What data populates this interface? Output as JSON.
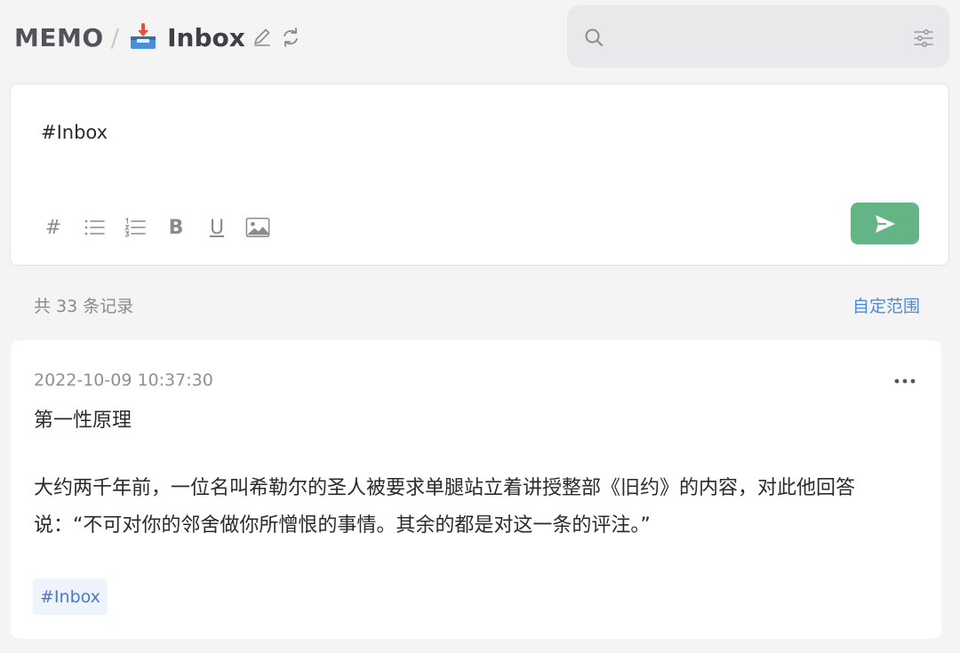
{
  "header": {
    "app_name": "MEMO",
    "separator": "/",
    "current_tag": "Inbox",
    "icons": [
      "inbox-tray-icon",
      "edit-pencil-icon",
      "sync-icon"
    ]
  },
  "search": {
    "placeholder": "",
    "value": "",
    "icons": [
      "search-icon",
      "filter-sliders-icon"
    ]
  },
  "editor": {
    "content": "#Inbox",
    "toolbar": {
      "tag": "#",
      "bold": "B",
      "underline": "U",
      "icons": [
        "bullet-list-icon",
        "ordered-list-icon",
        "image-icon"
      ]
    },
    "send_icon": "send-icon",
    "send_color": "#64b585"
  },
  "records": {
    "count_label": "共 33 条记录",
    "range_link": "自定范围"
  },
  "memos": [
    {
      "timestamp": "2022-10-09 10:37:30",
      "title": "第一性原理",
      "body": "大约两千年前，一位名叫希勒尔的圣人被要求单腿站立着讲授整部《旧约》的内容，对此他回答说：“不可对你的邻舍做你所憎恨的事情。其余的都是对这一条的评注。”",
      "tag": "#Inbox",
      "menu_icon": "more-horizontal-icon"
    }
  ],
  "colors": {
    "accent_link": "#4a8be0",
    "tag_bg": "#eef3fc",
    "tag_text": "#4a78d0",
    "page_bg": "#f4f4f5"
  }
}
